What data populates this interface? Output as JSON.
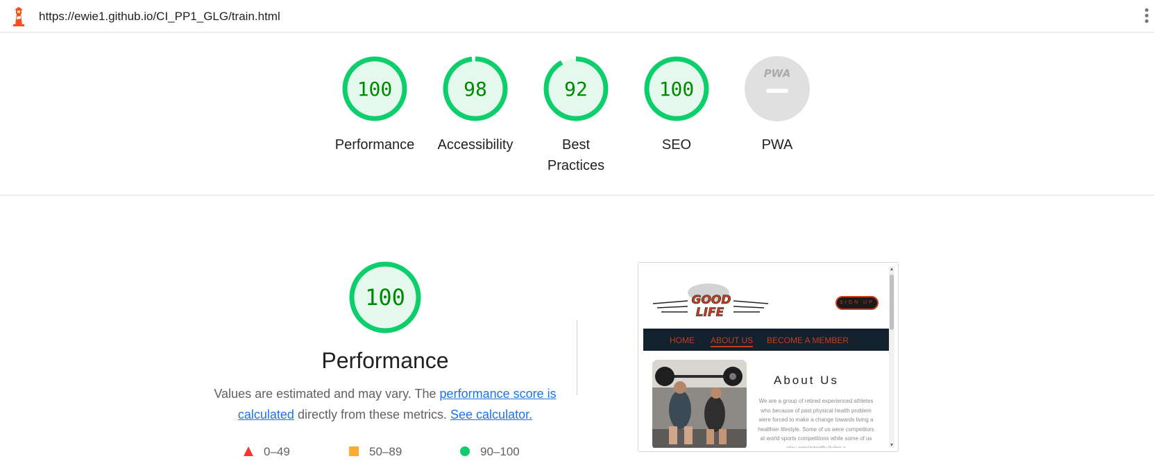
{
  "topbar": {
    "url": "https://ewie1.github.io/CI_PP1_GLG/train.html",
    "icon": "lighthouse-icon",
    "menu_icon": "kebab-menu-icon"
  },
  "gauges": [
    {
      "label": "Performance",
      "value": "100",
      "score": 100
    },
    {
      "label": "Accessibility",
      "value": "98",
      "score": 98
    },
    {
      "label": "Best Practices",
      "value": "92",
      "score": 92
    },
    {
      "label": "SEO",
      "value": "100",
      "score": 100
    },
    {
      "label": "PWA",
      "value": "PWA",
      "score": null
    }
  ],
  "performance": {
    "score": "100",
    "title": "Performance",
    "desc_prefix": "Values are estimated and may vary. The ",
    "link_score": "performance score is calculated",
    "desc_middle": " directly from these metrics. ",
    "link_calc": "See calculator."
  },
  "legend": [
    {
      "range": "0–49",
      "shape": "triangle",
      "color": "#ff3333"
    },
    {
      "range": "50–89",
      "shape": "square",
      "color": "#ffaa33"
    },
    {
      "range": "90–100",
      "shape": "circle",
      "color": "#0cce6b"
    }
  ],
  "thumbnail": {
    "logo_text": [
      "GOOD",
      "LIFE"
    ],
    "signup": "SIGN UP",
    "nav": [
      "HOME",
      "ABOUT US",
      "BECOME A MEMBER"
    ],
    "about_title": "About Us",
    "about_text": "We are a group of retired experienced athletes who because of past physical health problem were forced to make a change towards living a healthier lifestyle. Some of us were competitors at world sports competitions while some of us stay consistently living a"
  },
  "colors": {
    "pass": "#0cce6b",
    "pass_fill": "#e5f8ee",
    "pass_text": "#008800",
    "pwa_gray": "#e0e0e0",
    "link": "#1a73e8",
    "brand": "#c73e1d",
    "nav_bg": "#13202e"
  }
}
